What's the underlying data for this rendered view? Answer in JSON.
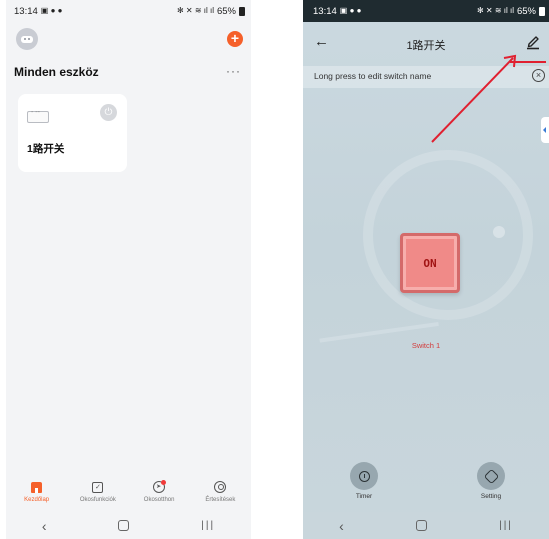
{
  "left": {
    "status": {
      "time": "13:14",
      "battery": "65%"
    },
    "section_title": "Minden eszköz",
    "more": "···",
    "add_icon": "+",
    "device": {
      "name": "1路开关",
      "power_icon": "⏻"
    },
    "nav": [
      {
        "label": "Kezdőlap",
        "icon": "home-icon",
        "active": true
      },
      {
        "label": "Okosfunkciók",
        "icon": "check-square-icon",
        "active": false
      },
      {
        "label": "Okosotthon",
        "icon": "navigate-icon",
        "active": false
      },
      {
        "label": "Értesítések",
        "icon": "profile-icon",
        "active": false
      }
    ],
    "sys_nav": {
      "back": "‹",
      "recent": "|||"
    }
  },
  "right": {
    "status": {
      "time": "13:14",
      "battery": "65%"
    },
    "title": "1路开关",
    "back": "←",
    "hint": "Long press to edit switch name",
    "hint_close": "×",
    "switch": {
      "state_label": "ON",
      "name": "Switch 1"
    },
    "controls": {
      "timer": "Timer",
      "setting": "Setting"
    },
    "sys_nav": {
      "back": "‹",
      "recent": "|||"
    }
  },
  "colors": {
    "accent": "#f5602a",
    "switch_on": "#f08a88",
    "annotation_arrow": "#e02030"
  }
}
